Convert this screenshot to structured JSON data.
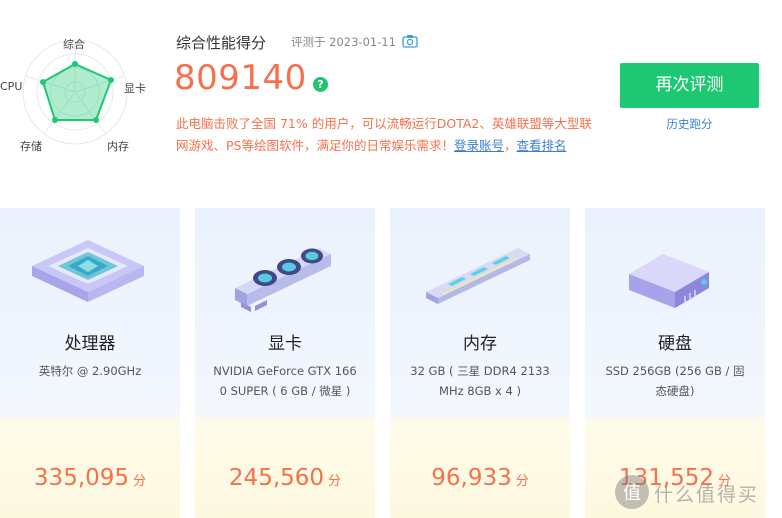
{
  "radar": {
    "labels": {
      "overall": "综合",
      "gpu": "显卡",
      "memory": "内存",
      "storage": "存储",
      "cpu": "CPU"
    }
  },
  "summary": {
    "title": "综合性能得分",
    "date": "评测于 2023-01-11",
    "score": "809140",
    "help_symbol": "?",
    "description": "此电脑击败了全国 71% 的用户，可以流畅运行DOTA2、英雄联盟等大型联网游戏、PS等绘图软件，满足你的日常娱乐需求！",
    "login_link": "登录账号",
    "separator": "，",
    "ranking_link": "查看排名"
  },
  "actions": {
    "retest": "再次评测",
    "history": "历史跑分"
  },
  "cards": [
    {
      "title": "处理器",
      "spec": "英特尔 @ 2.90GHz",
      "score": "335,095",
      "unit": "分",
      "icon": "cpu-chip-icon"
    },
    {
      "title": "显卡",
      "spec": "NVIDIA GeForce GTX 1660 SUPER ( 6 GB / 微星 )",
      "score": "245,560",
      "unit": "分",
      "icon": "graphics-card-icon"
    },
    {
      "title": "内存",
      "spec": "32 GB ( 三星 DDR4 2133MHz 8GB x 4 )",
      "score": "96,933",
      "unit": "分",
      "icon": "ram-stick-icon"
    },
    {
      "title": "硬盘",
      "spec": "SSD 256GB (256 GB / 固态硬盘)",
      "score": "131,552",
      "unit": "分",
      "icon": "hard-drive-icon"
    }
  ],
  "watermark": {
    "text": "什么值得买",
    "symbol": "值"
  },
  "colors": {
    "accent": "#1ec872",
    "score": "#f5714c",
    "link": "#3b7fd4"
  }
}
